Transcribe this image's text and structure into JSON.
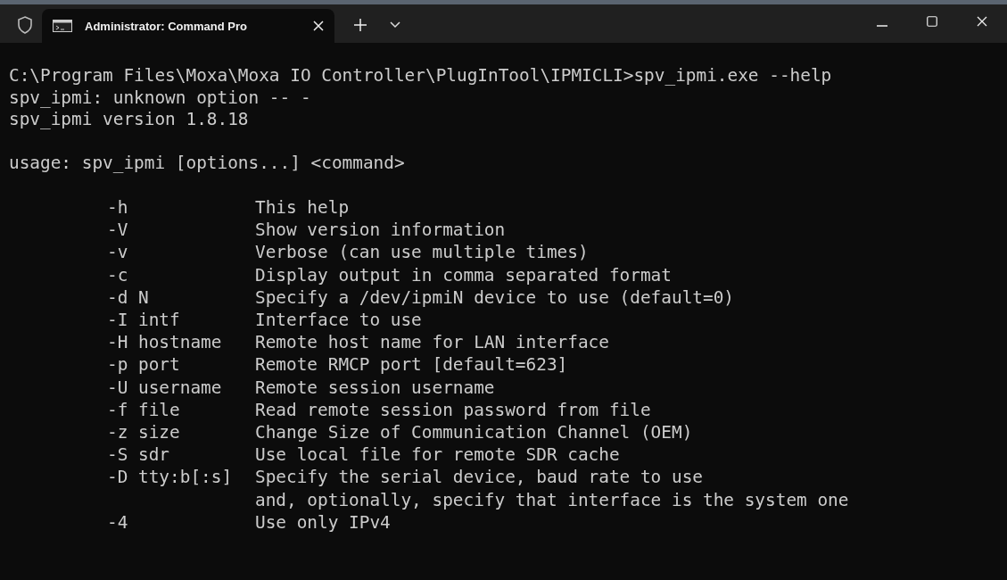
{
  "tab": {
    "title": "Administrator: Command Pro"
  },
  "output": [
    "C:\\Program Files\\Moxa\\Moxa IO Controller\\PlugInTool\\IPMICLI>spv_ipmi.exe --help",
    "spv_ipmi: unknown option -- -",
    "spv_ipmi version 1.8.18"
  ],
  "usage": "usage: spv_ipmi [options...] <command>",
  "options": [
    {
      "flag": "-h",
      "description": [
        "This help"
      ]
    },
    {
      "flag": "-V",
      "description": [
        "Show version information"
      ]
    },
    {
      "flag": "-v",
      "description": [
        "Verbose (can use multiple times)"
      ]
    },
    {
      "flag": "-c",
      "description": [
        "Display output in comma separated format"
      ]
    },
    {
      "flag": "-d N",
      "description": [
        "Specify a /dev/ipmiN device to use (default=0)"
      ]
    },
    {
      "flag": "-I intf",
      "description": [
        "Interface to use"
      ]
    },
    {
      "flag": "-H hostname",
      "description": [
        "Remote host name for LAN interface"
      ]
    },
    {
      "flag": "-p port",
      "description": [
        "Remote RMCP port [default=623]"
      ]
    },
    {
      "flag": "-U username",
      "description": [
        "Remote session username"
      ]
    },
    {
      "flag": "-f file",
      "description": [
        "Read remote session password from file"
      ]
    },
    {
      "flag": "-z size",
      "description": [
        "Change Size of Communication Channel (OEM)"
      ]
    },
    {
      "flag": "-S sdr",
      "description": [
        "Use local file for remote SDR cache"
      ]
    },
    {
      "flag": "-D tty:b[:s]",
      "description": [
        "Specify the serial device, baud rate to use",
        "and, optionally, specify that interface is the system one"
      ]
    },
    {
      "flag": "-4",
      "description": [
        "Use only IPv4"
      ]
    }
  ]
}
